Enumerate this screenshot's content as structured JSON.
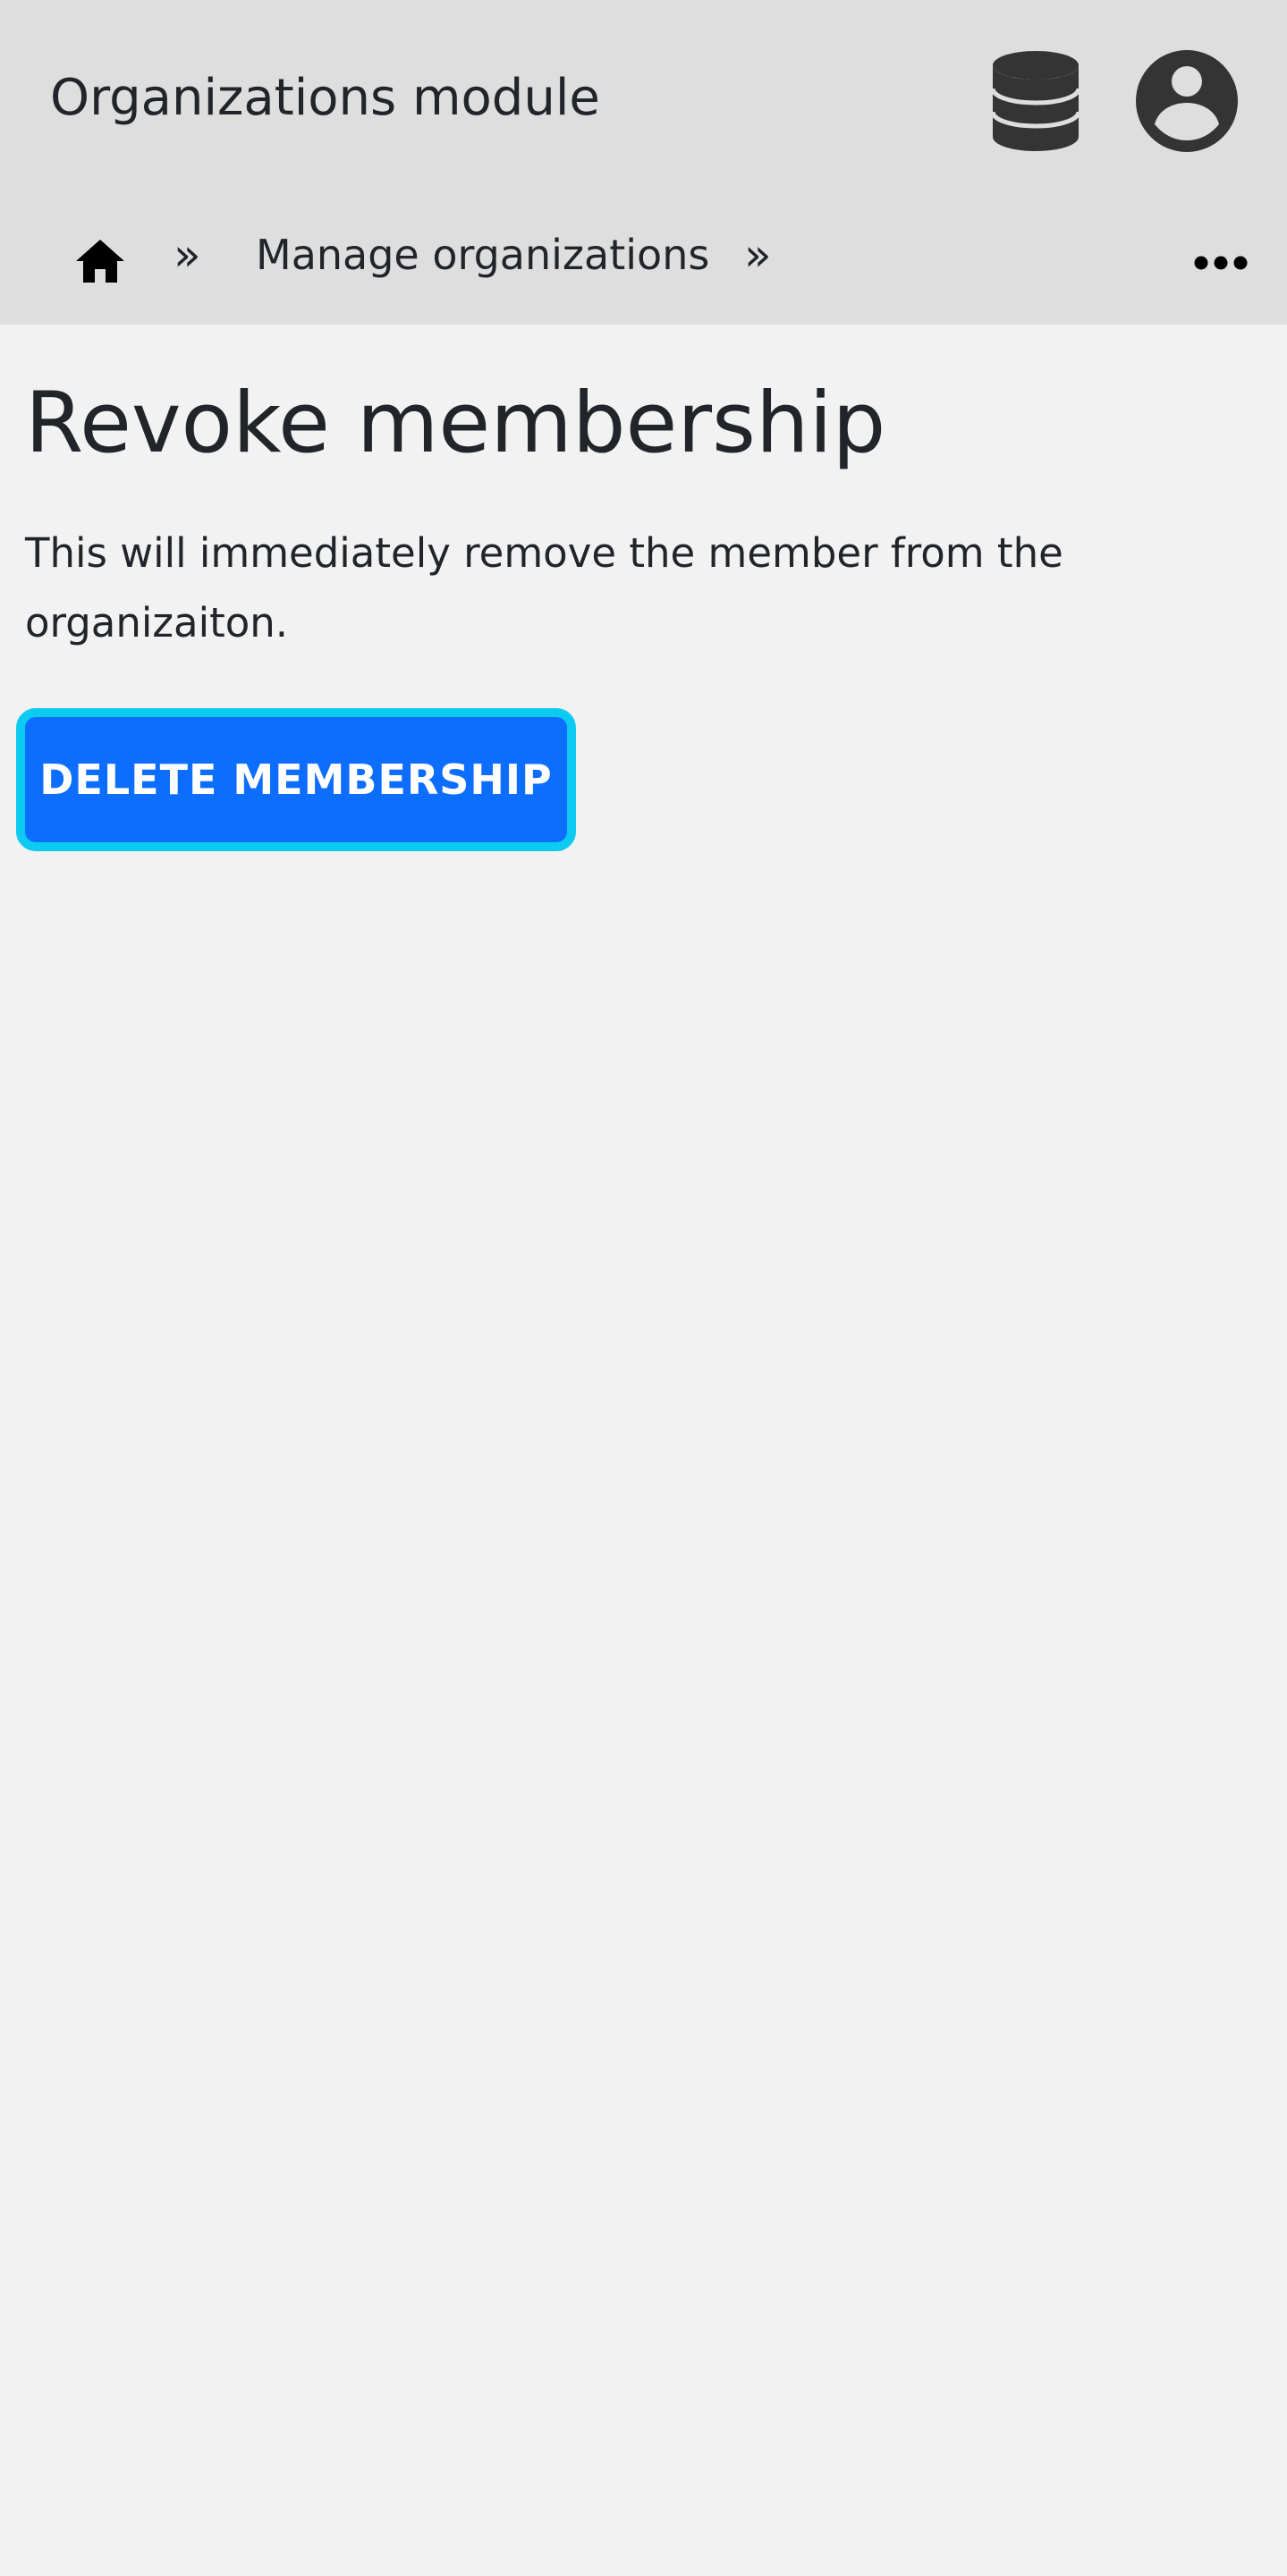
{
  "header": {
    "app_title": "Organizations module",
    "icons": {
      "database": "database-icon",
      "user": "user-circle-icon"
    }
  },
  "breadcrumb": {
    "home_icon": "home-icon",
    "separator": "»",
    "items": [
      {
        "label": "Manage organizations"
      }
    ],
    "more_icon": "ellipsis-icon"
  },
  "main": {
    "title": "Revoke membership",
    "description": "This will immediately remove the member from the organizaiton.",
    "delete_button_label": "DELETE MEMBERSHIP"
  },
  "colors": {
    "header_bg": "#dedede",
    "page_bg": "#f2f2f2",
    "primary_button": "#0d6efd",
    "button_focus_ring": "#0dcaf0",
    "icon_dark": "#343434"
  }
}
